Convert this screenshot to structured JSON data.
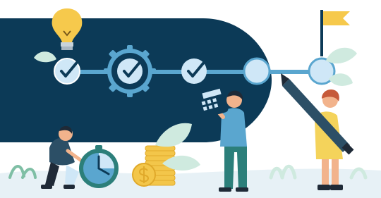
{
  "illustration": {
    "theme": "project-progress-milestones",
    "colors": {
      "navy": "#0c3a57",
      "light_blue": "#cfe7f7",
      "mid_blue": "#5aa6cf",
      "leaf_green": "#cfeadf",
      "leaf_stroke": "#7fbfa5",
      "coin_gold": "#f3c64a",
      "coin_dark": "#e0a92a",
      "bulb_yellow": "#f6c94c",
      "flag_yellow": "#f6c94c",
      "dress_yellow": "#f4d35b",
      "person_teal": "#2c7f7a",
      "skin": "#f2b38c",
      "hair_dark": "#1f2a37",
      "hair_red": "#c65a3a"
    },
    "milestones": [
      {
        "state": "completed",
        "icon": "check-icon"
      },
      {
        "state": "completed",
        "icon": "check-icon"
      },
      {
        "state": "completed",
        "icon": "check-icon"
      },
      {
        "state": "pending",
        "icon": ""
      },
      {
        "state": "pending",
        "icon": ""
      }
    ],
    "milestones_completed": 3,
    "milestones_total": 5,
    "icons": [
      "lightbulb-icon",
      "gear-icon",
      "flag-icon",
      "calculator-icon",
      "stopwatch-icon",
      "coin-stack-icon",
      "dollar-icon",
      "pen-icon",
      "leaf-icon"
    ]
  }
}
